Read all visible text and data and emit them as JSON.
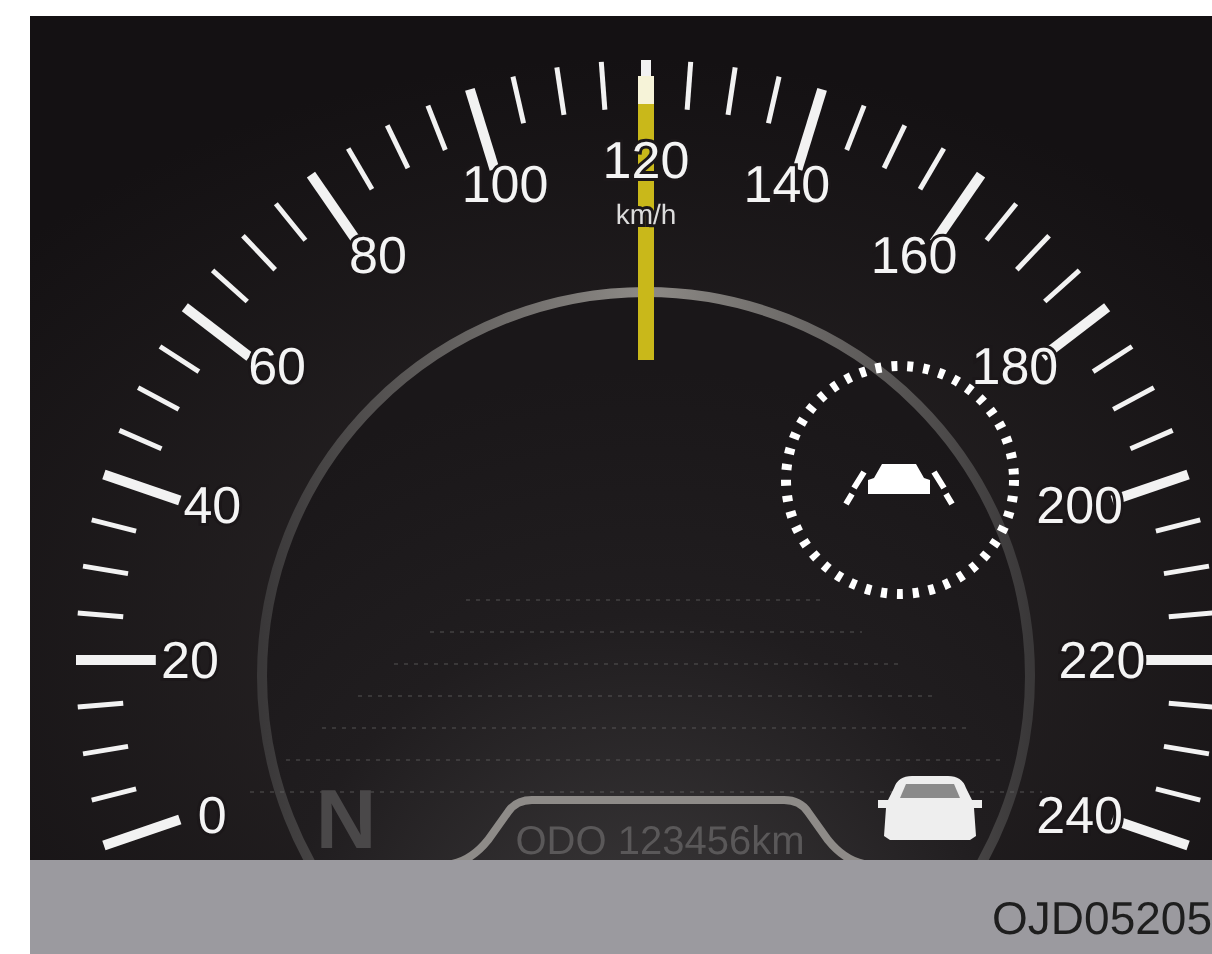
{
  "speedometer": {
    "top_label": "120",
    "unit": "km/h",
    "left_labels": [
      "100",
      "80",
      "60",
      "40",
      "20",
      "0"
    ],
    "right_labels": [
      "140",
      "160",
      "180",
      "200",
      "220",
      "240"
    ],
    "needle": {
      "level": 0.5
    }
  },
  "display": {
    "gear": "N",
    "odometer": "ODO 123456km"
  },
  "caption": "OJD05205"
}
